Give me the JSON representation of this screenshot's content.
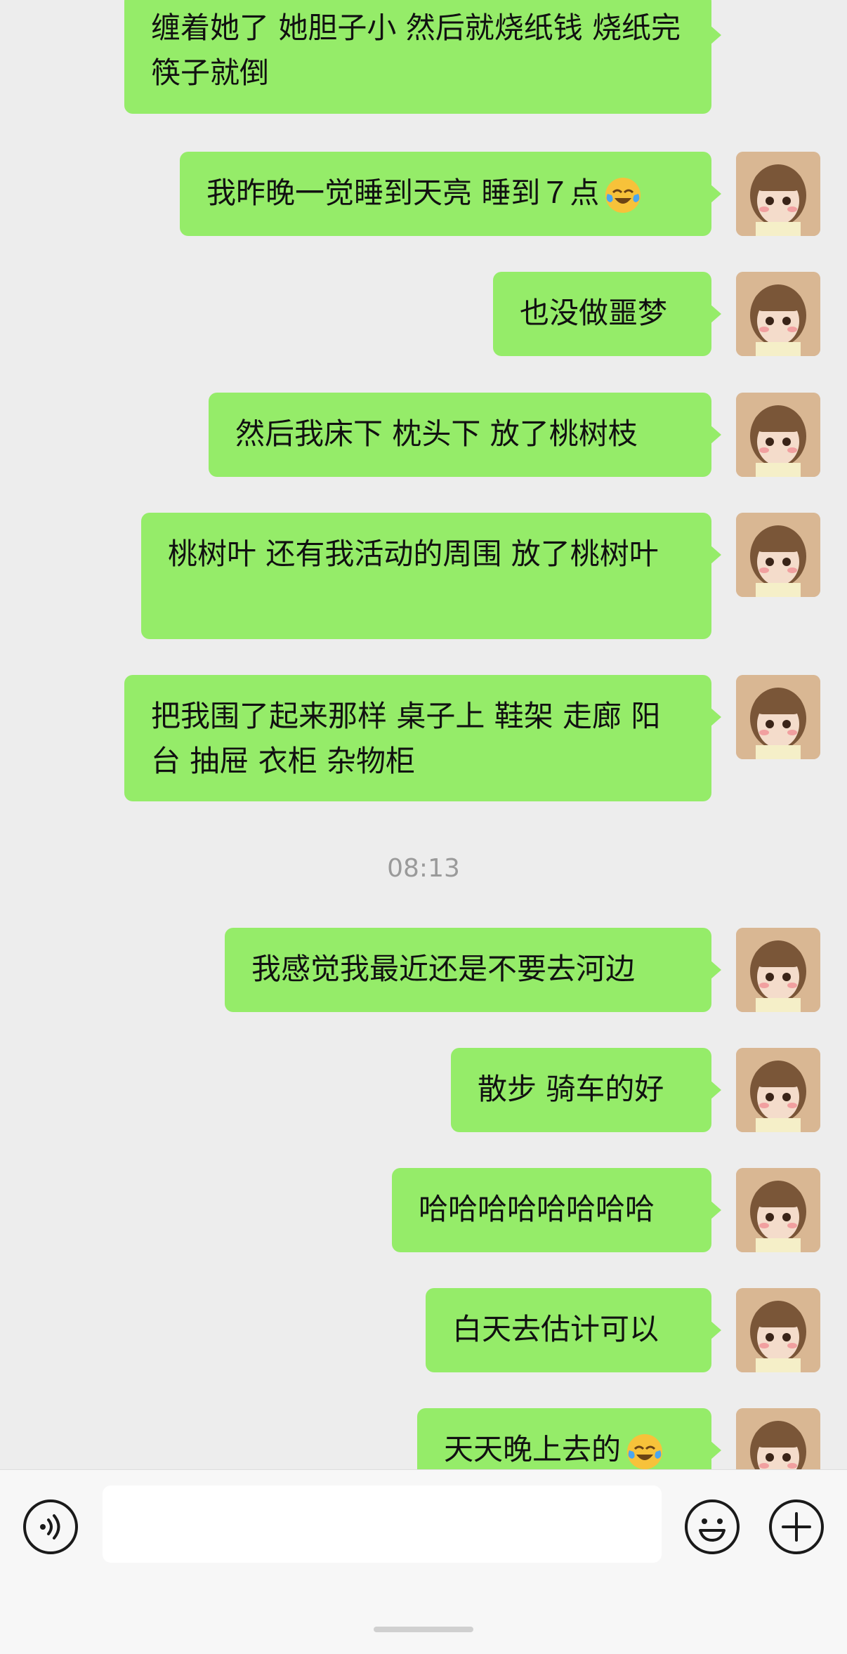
{
  "messages": [
    {
      "text": "缠着她了 她胆子小 然后就烧纸钱 烧纸完筷子就倒",
      "emoji": ""
    },
    {
      "text": "我昨晚一觉睡到天亮 睡到７点",
      "emoji": "crying-laughing-emoji"
    },
    {
      "text": "也没做噩梦",
      "emoji": ""
    },
    {
      "text": "然后我床下 枕头下 放了桃树枝",
      "emoji": ""
    },
    {
      "text": "桃树叶 还有我活动的周围 放了桃树叶",
      "emoji": ""
    },
    {
      "text": "把我围了起来那样 桌子上 鞋架 走廊 阳台 抽屉 衣柜 杂物柜",
      "emoji": ""
    },
    {
      "text": "我感觉我最近还是不要去河边",
      "emoji": ""
    },
    {
      "text": "散步 骑车的好",
      "emoji": ""
    },
    {
      "text": "哈哈哈哈哈哈哈哈",
      "emoji": ""
    },
    {
      "text": "白天去估计可以",
      "emoji": ""
    },
    {
      "text": "天天晚上去的",
      "emoji": "crying-laughing-emoji"
    }
  ],
  "timestamp": "08:13",
  "input": {
    "placeholder": "",
    "voice_icon": "voice-icon",
    "emoji_icon": "emoji-icon",
    "add_icon": "add-icon"
  },
  "colors": {
    "bubble": "#95ec69",
    "background": "#ededed",
    "input_bar": "#f7f7f7"
  }
}
